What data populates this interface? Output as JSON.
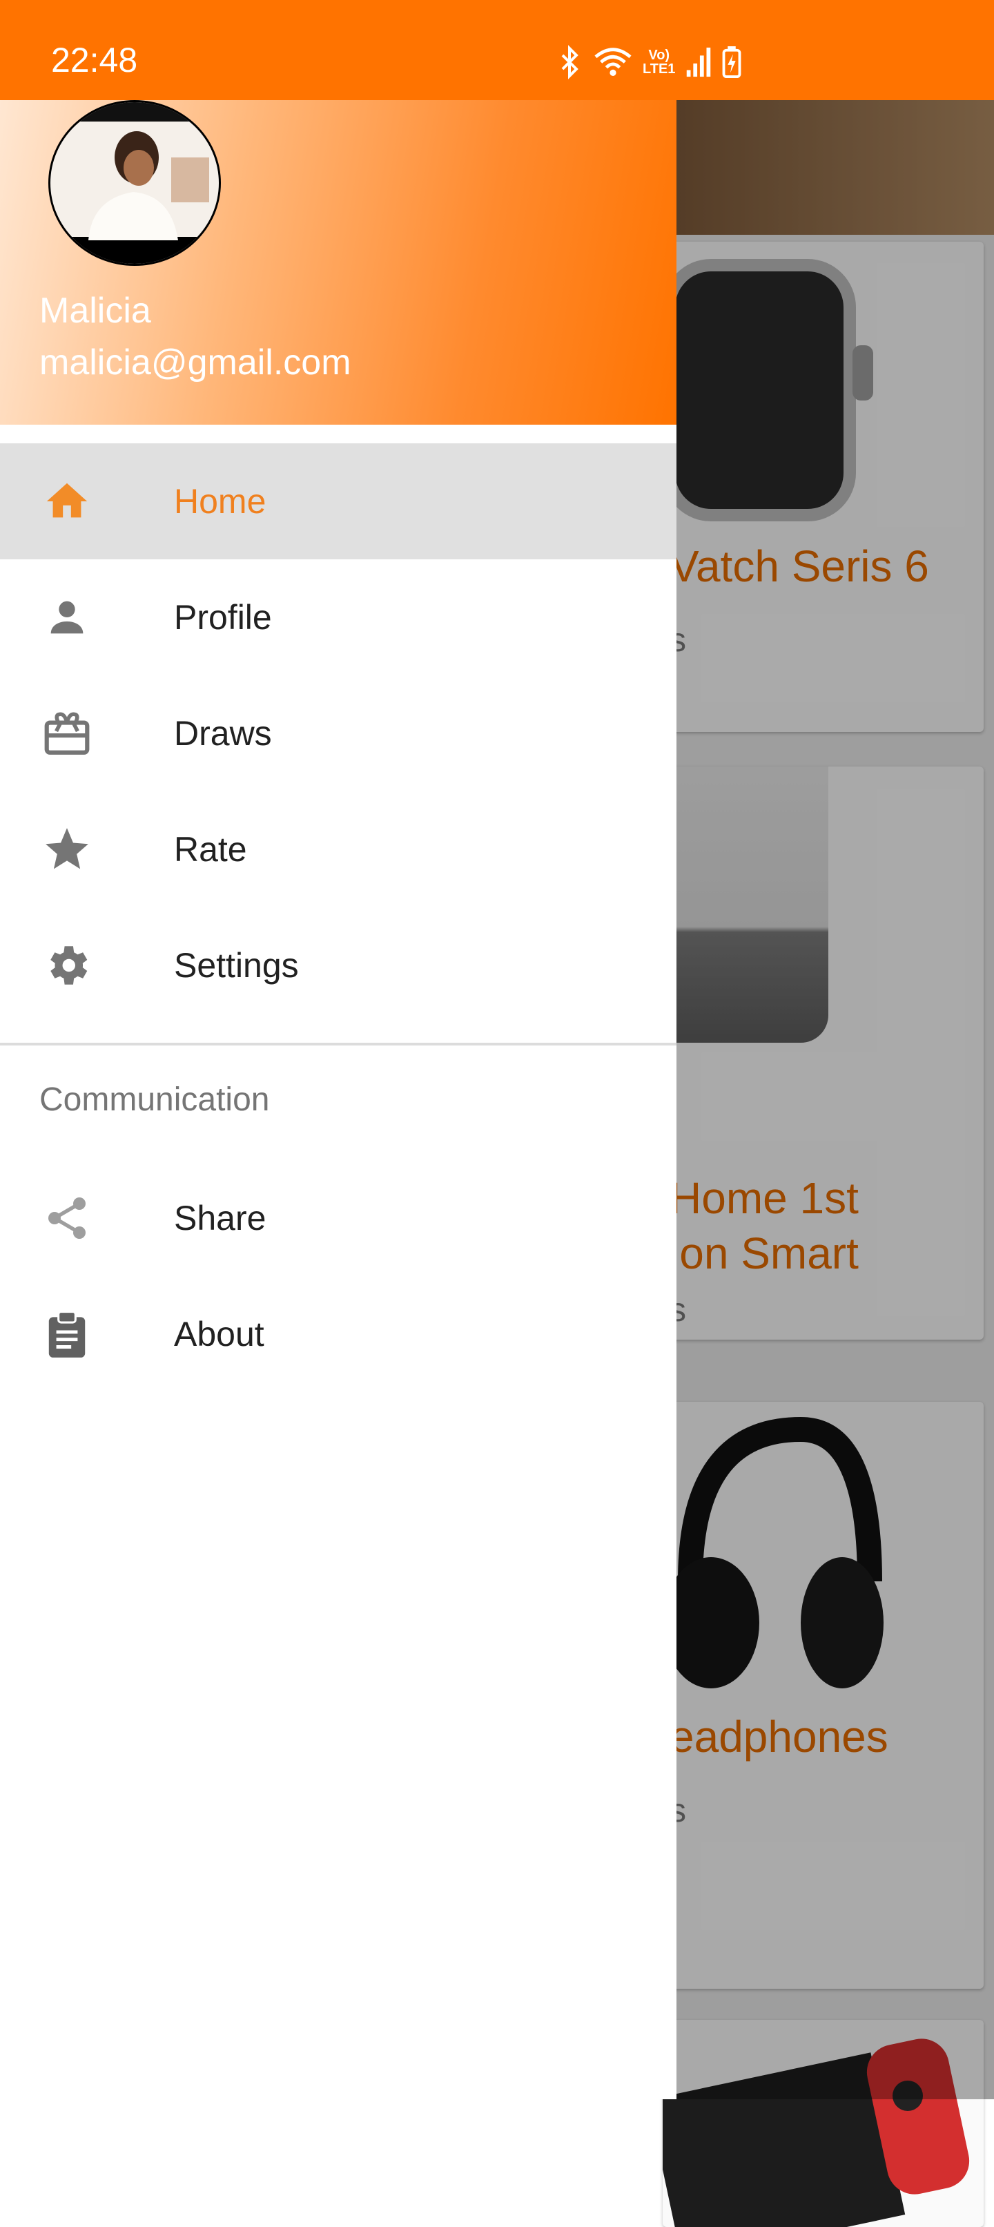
{
  "status_bar": {
    "time": "22:48",
    "network_label_top": "Vo)",
    "network_label_bottom": "LTE1",
    "icons": [
      "bluetooth-icon",
      "wifi-icon",
      "lte-icon",
      "signal-icon",
      "battery-charging-icon"
    ]
  },
  "drawer": {
    "header": {
      "user_name": "Malicia",
      "user_email": "malicia@gmail.com"
    },
    "items": [
      {
        "label": "Home",
        "icon": "home-icon",
        "active": true
      },
      {
        "label": "Profile",
        "icon": "person-icon",
        "active": false
      },
      {
        "label": "Draws",
        "icon": "gift-card-icon",
        "active": false
      },
      {
        "label": "Rate",
        "icon": "star-icon",
        "active": false
      },
      {
        "label": "Settings",
        "icon": "gear-icon",
        "active": false
      }
    ],
    "section_header": "Communication",
    "communication_items": [
      {
        "label": "Share",
        "icon": "share-icon"
      },
      {
        "label": "About",
        "icon": "clipboard-icon"
      }
    ]
  },
  "background_products": [
    {
      "title": "Vatch Seris 6",
      "subtitle": "s"
    },
    {
      "title": "Home 1st\nion Smart\n",
      "subtitle": "s"
    },
    {
      "title": "eadphones",
      "subtitle": "s"
    },
    {
      "title": "",
      "subtitle": ""
    }
  ],
  "colors": {
    "brand_orange": "#ff7300",
    "active_label": "#f0801e",
    "product_title": "#e46a00",
    "icon_gray": "#757575"
  }
}
